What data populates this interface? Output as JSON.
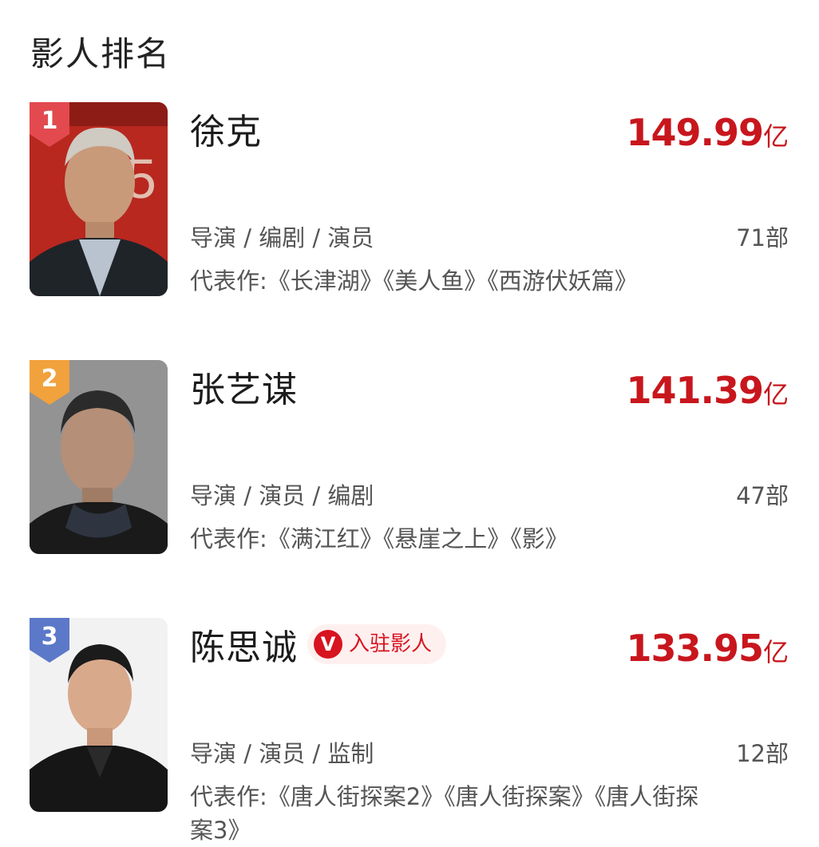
{
  "page": {
    "title": "影人排名"
  },
  "colors": {
    "accent": "#c8161d",
    "rank_1": "#e24a4f",
    "rank_2": "#f1a23c",
    "rank_3": "#5b78c9"
  },
  "entries": [
    {
      "rank": "1",
      "name": "徐克",
      "boxoffice_value": "149.99",
      "boxoffice_unit": "亿",
      "roles": "导演 / 编剧 / 演员",
      "film_count": "71部",
      "works": "代表作:《长津湖》《美人鱼》《西游伏妖篇》",
      "photo_icon": "portrait-photo"
    },
    {
      "rank": "2",
      "name": "张艺谋",
      "boxoffice_value": "141.39",
      "boxoffice_unit": "亿",
      "roles": "导演 / 演员 / 编剧",
      "film_count": "47部",
      "works": "代表作:《满江红》《悬崖之上》《影》",
      "photo_icon": "portrait-photo"
    },
    {
      "rank": "3",
      "name": "陈思诚",
      "verified_icon_text": "V",
      "verified_label": "入驻影人",
      "boxoffice_value": "133.95",
      "boxoffice_unit": "亿",
      "roles": "导演 / 演员 / 监制",
      "film_count": "12部",
      "works": "代表作:《唐人街探案2》《唐人街探案》《唐人街探案3》",
      "photo_icon": "portrait-photo"
    }
  ]
}
